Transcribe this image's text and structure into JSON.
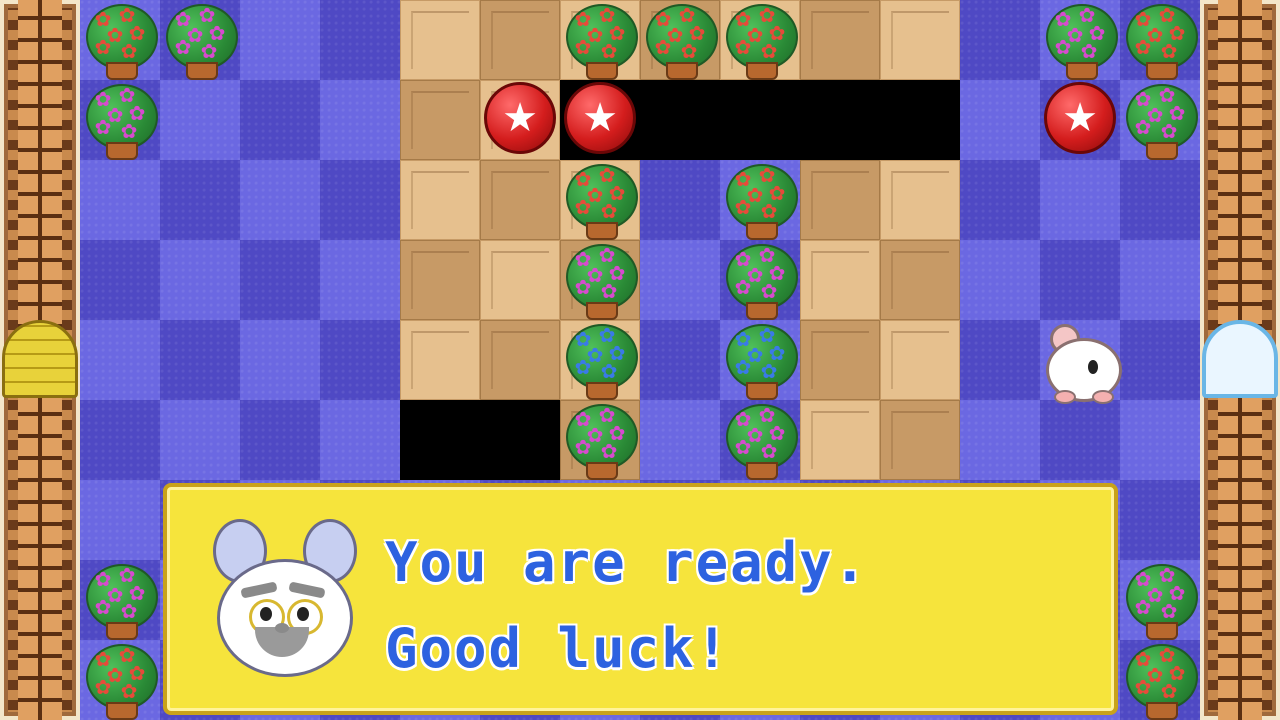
{
  "dialog": {
    "line1": "You are ready.",
    "line2": "Good luck!",
    "speaker": "elder-hamster"
  },
  "colors": {
    "floor_purple_light": "#6b68e2",
    "floor_purple_dark": "#4f49c4",
    "tile_light": "#e6c08e",
    "tile_dark": "#c79a66",
    "dialog_bg": "#f6e43c",
    "dialog_text": "#2d62e0",
    "star_ball": "#d41d1d"
  },
  "icons": {
    "player": "hamster-icon",
    "pushable": "star-ball-icon",
    "obstacle": "flower-pot-icon",
    "exit_left": "locked-gate-icon",
    "exit_right": "open-door-icon"
  }
}
